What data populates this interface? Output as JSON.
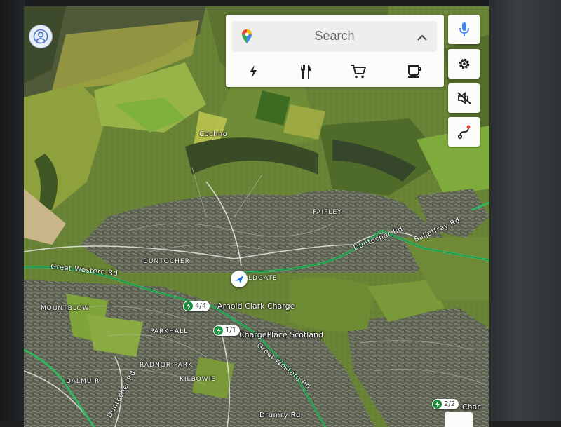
{
  "search_panel": {
    "placeholder": "Search",
    "categories": [
      {
        "name": "ev-charging",
        "icon": "lightning-bolt-icon"
      },
      {
        "name": "restaurants",
        "icon": "fork-knife-icon"
      },
      {
        "name": "groceries",
        "icon": "shopping-cart-icon"
      },
      {
        "name": "coffee",
        "icon": "coffee-cup-icon"
      }
    ]
  },
  "side_controls": [
    {
      "name": "voice",
      "icon": "microphone-icon"
    },
    {
      "name": "settings",
      "icon": "gear-icon"
    },
    {
      "name": "mute",
      "icon": "muted-speaker-icon"
    },
    {
      "name": "route-options",
      "icon": "route-icon"
    }
  ],
  "map": {
    "places": [
      "Cochno",
      "Faifley",
      "Duntocher",
      "Mountblow",
      "Parkhall",
      "Radnor Park",
      "Kilbowie",
      "Dalmuir"
    ],
    "roads": [
      "Great Western Rd",
      "Duntocher Rd",
      "Baljaffray Rd",
      "Great Western Rd",
      "Duntocher Rd",
      "Drumry Rd"
    ],
    "partial_labels": [
      "LDGATE",
      "Char"
    ],
    "chargers": [
      {
        "name": "Arnold Clark Charge",
        "availability": "4/4"
      },
      {
        "name": "ChargePlace Scotland",
        "availability": "1/1"
      },
      {
        "name": "",
        "availability": "2/2"
      }
    ]
  },
  "colors": {
    "route_green": "#2fb860",
    "panel_bg": "#fbfbf9",
    "accent_blue": "#4285f4",
    "charger_green": "#1e8e3e"
  }
}
